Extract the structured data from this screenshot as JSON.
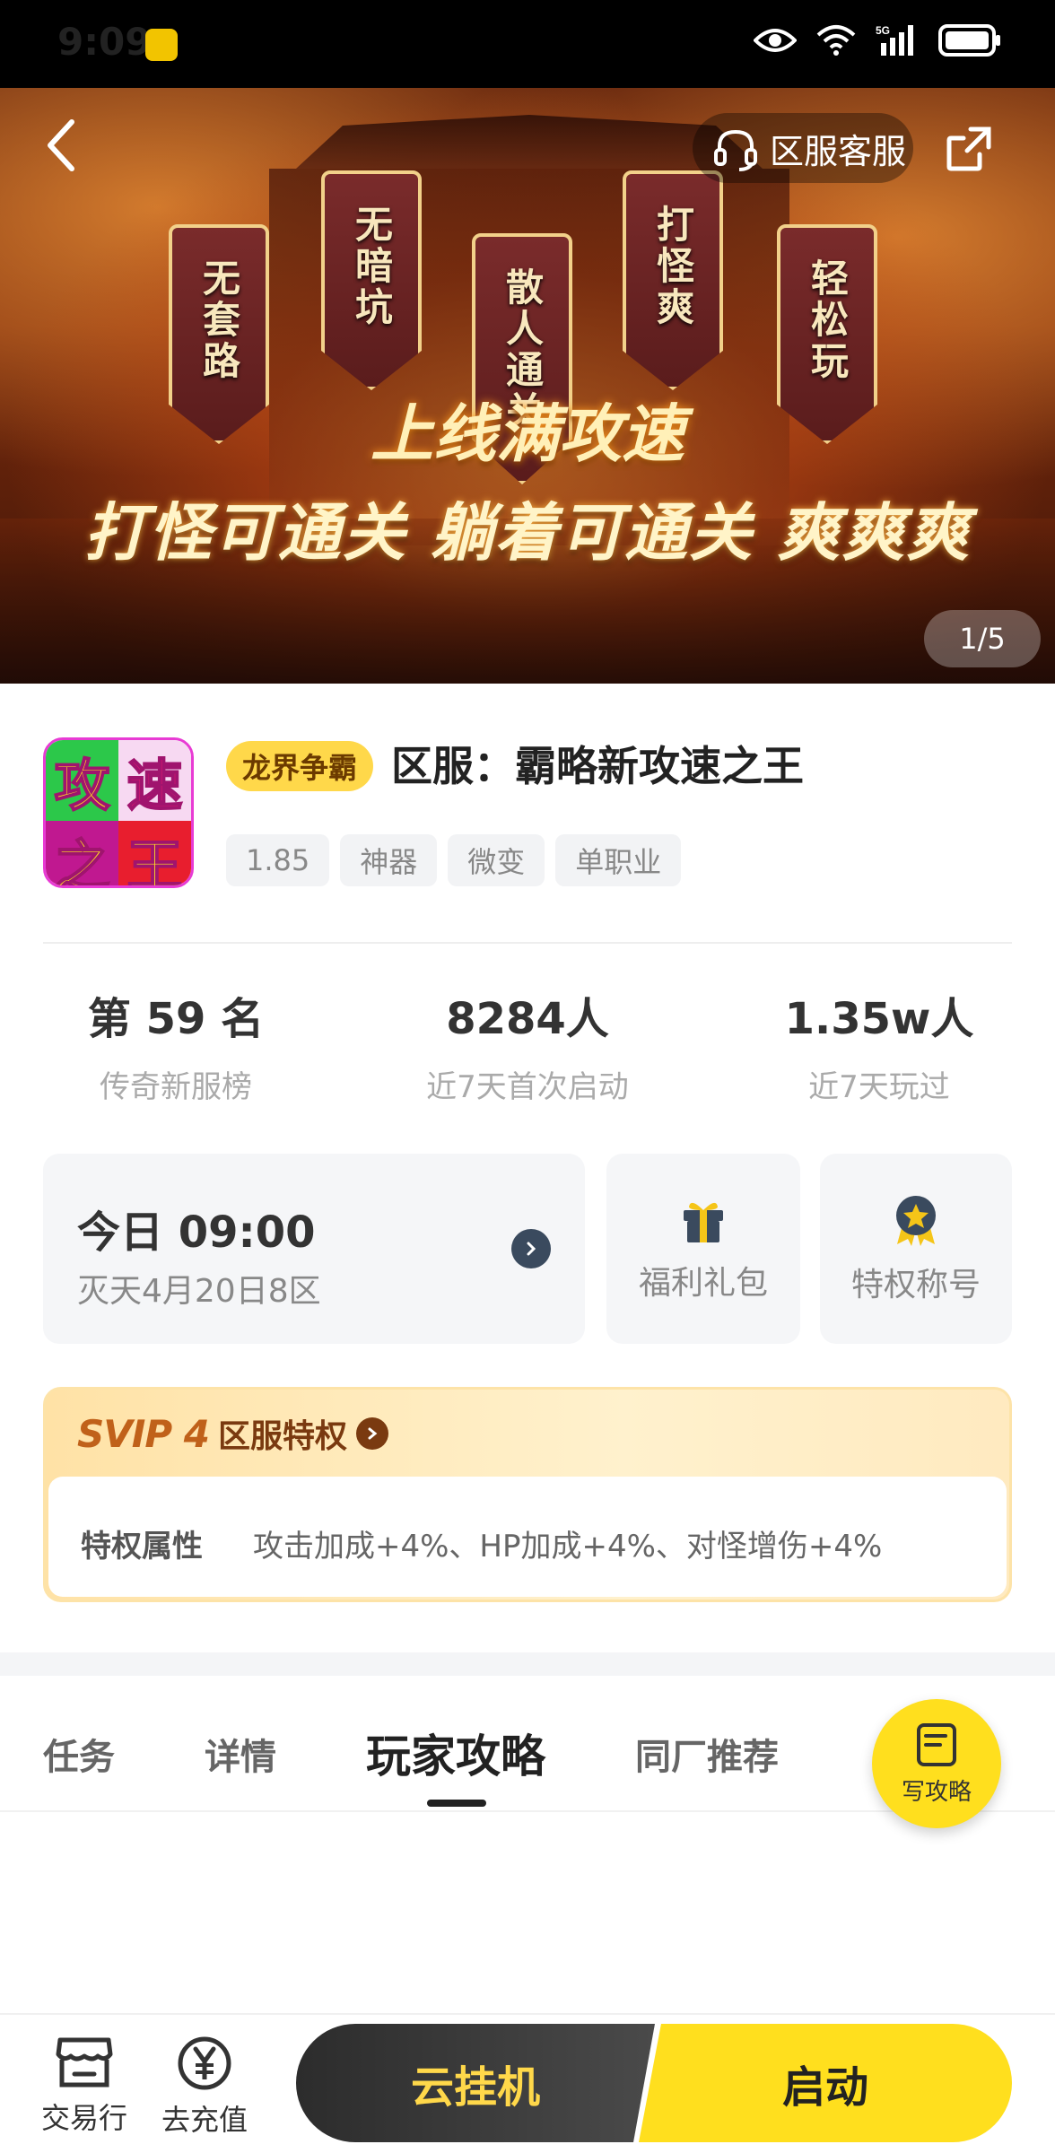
{
  "status_bar": {
    "time": "9:09"
  },
  "banner": {
    "pennants": [
      "无套路",
      "无暗坑",
      "散人通关",
      "打怪爽",
      "轻松玩"
    ],
    "slogan_main": "上线满攻速",
    "slogan_sub": "打怪可通关 躺着可通关 爽爽爽",
    "customer_service_label": "区服客服",
    "page_indicator": "1/5"
  },
  "game": {
    "icon_chars": [
      "攻",
      "速",
      "之",
      "王"
    ],
    "tag_label": "龙界争霸",
    "title": "区服：霸略新攻速之王",
    "tags": [
      "1.85",
      "神器",
      "微变",
      "单职业"
    ]
  },
  "stats": [
    {
      "value": "第 59 名",
      "label": "传奇新服榜"
    },
    {
      "value": "8284人",
      "label": "近7天首次启动"
    },
    {
      "value": "1.35w人",
      "label": "近7天玩过"
    }
  ],
  "server_open": {
    "time": "今日 09:00",
    "server": "灭天4月20日8区"
  },
  "quick_cards": {
    "gift": "福利礼包",
    "title": "特权称号"
  },
  "svip": {
    "badge": "SVIP 4",
    "title": "区服特权",
    "attr_key": "特权属性",
    "attr_value": "攻击加成+4%、HP加成+4%、对怪增伤+4%"
  },
  "tabs": [
    {
      "label": "任务"
    },
    {
      "label": "详情"
    },
    {
      "label": "玩家攻略"
    },
    {
      "label": "同厂推荐"
    }
  ],
  "write_button": {
    "label": "写攻略"
  },
  "bottom_bar": {
    "trade": "交易行",
    "recharge": "去充值",
    "cloud": "云挂机",
    "start": "启动"
  },
  "colors": {
    "accent": "#ffdf1e",
    "dark_button": "#2c2c2c",
    "svip_text": "#7a3a10"
  }
}
